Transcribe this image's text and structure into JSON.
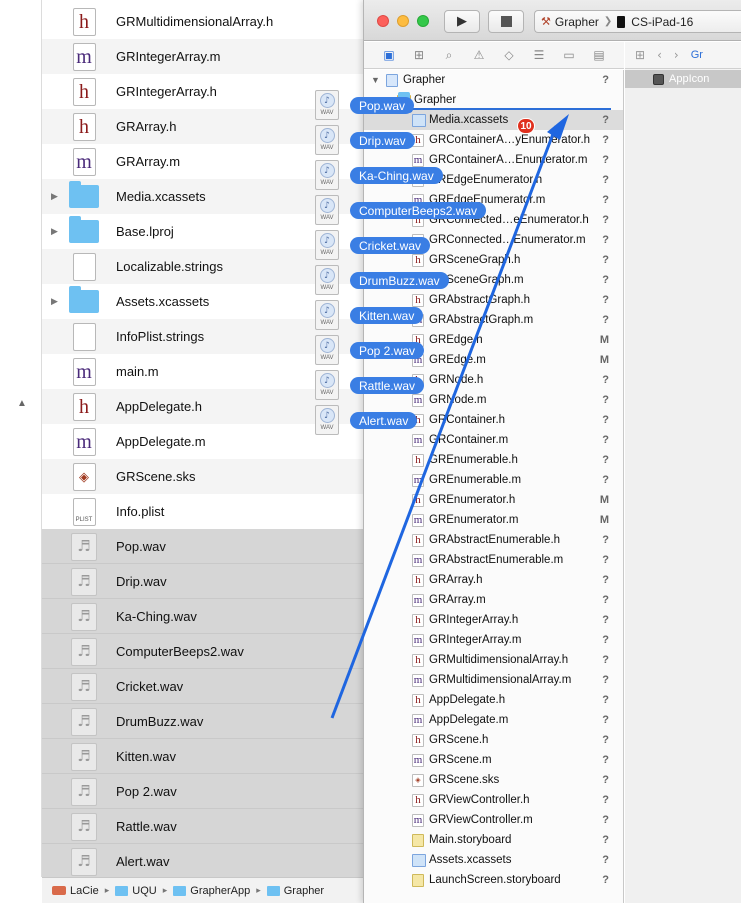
{
  "finder": {
    "rows": [
      {
        "name": "GRMultidimensionalArray.h",
        "type": "h"
      },
      {
        "name": "GRIntegerArray.m",
        "type": "m"
      },
      {
        "name": "GRIntegerArray.h",
        "type": "h"
      },
      {
        "name": "GRArray.h",
        "type": "h"
      },
      {
        "name": "GRArray.m",
        "type": "m"
      },
      {
        "name": "Media.xcassets",
        "type": "folder"
      },
      {
        "name": "Base.lproj",
        "type": "folder"
      },
      {
        "name": "Localizable.strings",
        "type": "plain"
      },
      {
        "name": "Assets.xcassets",
        "type": "folder"
      },
      {
        "name": "InfoPlist.strings",
        "type": "plain"
      },
      {
        "name": "main.m",
        "type": "m"
      },
      {
        "name": "AppDelegate.h",
        "type": "h"
      },
      {
        "name": "AppDelegate.m",
        "type": "m"
      },
      {
        "name": "GRScene.sks",
        "type": "sks"
      },
      {
        "name": "Info.plist",
        "type": "plist"
      },
      {
        "name": "Pop.wav",
        "type": "audio"
      },
      {
        "name": "Drip.wav",
        "type": "audio"
      },
      {
        "name": "Ka-Ching.wav",
        "type": "audio"
      },
      {
        "name": "ComputerBeeps2.wav",
        "type": "audio"
      },
      {
        "name": "Cricket.wav",
        "type": "audio"
      },
      {
        "name": "DrumBuzz.wav",
        "type": "audio"
      },
      {
        "name": "Kitten.wav",
        "type": "audio"
      },
      {
        "name": "Pop 2.wav",
        "type": "audio"
      },
      {
        "name": "Rattle.wav",
        "type": "audio"
      },
      {
        "name": "Alert.wav",
        "type": "audio"
      }
    ],
    "plist_label": "PLIST",
    "audio_glyph": "♬",
    "path": [
      "LaCie",
      "UQU",
      "GrapherApp",
      "Grapher"
    ]
  },
  "drag": {
    "items": [
      "Pop.wav",
      "Drip.wav",
      "Ka-Ching.wav",
      "ComputerBeeps2.wav",
      "Cricket.wav",
      "DrumBuzz.wav",
      "Kitten.wav",
      "Pop 2.wav",
      "Rattle.wav",
      "Alert.wav"
    ],
    "icon_label": "WAV",
    "badge_count": "10"
  },
  "xcode": {
    "scheme_app": "Grapher",
    "scheme_device": "CS-iPad-16",
    "navigator": [
      {
        "name": "Grapher",
        "type": "proj",
        "indent": 0,
        "status": "?"
      },
      {
        "name": "Grapher",
        "type": "folder",
        "indent": 1,
        "status": ""
      },
      {
        "name": "Media.xcassets",
        "type": "assets",
        "indent": 2,
        "status": "?"
      },
      {
        "name": "GRContainerA…yEnumerator.h",
        "type": "h",
        "indent": 2,
        "status": "?"
      },
      {
        "name": "GRContainerA…Enumerator.m",
        "type": "m",
        "indent": 2,
        "status": "?"
      },
      {
        "name": "GREdgeEnumerator.h",
        "type": "h",
        "indent": 2,
        "status": "?"
      },
      {
        "name": "GREdgeEnumerator.m",
        "type": "m",
        "indent": 2,
        "status": "?"
      },
      {
        "name": "GRConnected…eEnumerator.h",
        "type": "h",
        "indent": 2,
        "status": "?"
      },
      {
        "name": "GRConnected…Enumerator.m",
        "type": "m",
        "indent": 2,
        "status": "?"
      },
      {
        "name": "GRSceneGraph.h",
        "type": "h",
        "indent": 2,
        "status": "?"
      },
      {
        "name": "GRSceneGraph.m",
        "type": "m",
        "indent": 2,
        "status": "?"
      },
      {
        "name": "GRAbstractGraph.h",
        "type": "h",
        "indent": 2,
        "status": "?"
      },
      {
        "name": "GRAbstractGraph.m",
        "type": "m",
        "indent": 2,
        "status": "?"
      },
      {
        "name": "GREdge.h",
        "type": "h",
        "indent": 2,
        "status": "M"
      },
      {
        "name": "GREdge.m",
        "type": "m",
        "indent": 2,
        "status": "M"
      },
      {
        "name": "GRNode.h",
        "type": "h",
        "indent": 2,
        "status": "?"
      },
      {
        "name": "GRNode.m",
        "type": "m",
        "indent": 2,
        "status": "?"
      },
      {
        "name": "GRContainer.h",
        "type": "h",
        "indent": 2,
        "status": "?"
      },
      {
        "name": "GRContainer.m",
        "type": "m",
        "indent": 2,
        "status": "?"
      },
      {
        "name": "GREnumerable.h",
        "type": "h",
        "indent": 2,
        "status": "?"
      },
      {
        "name": "GREnumerable.m",
        "type": "m",
        "indent": 2,
        "status": "?"
      },
      {
        "name": "GREnumerator.h",
        "type": "h",
        "indent": 2,
        "status": "M"
      },
      {
        "name": "GREnumerator.m",
        "type": "m",
        "indent": 2,
        "status": "M"
      },
      {
        "name": "GRAbstractEnumerable.h",
        "type": "h",
        "indent": 2,
        "status": "?"
      },
      {
        "name": "GRAbstractEnumerable.m",
        "type": "m",
        "indent": 2,
        "status": "?"
      },
      {
        "name": "GRArray.h",
        "type": "h",
        "indent": 2,
        "status": "?"
      },
      {
        "name": "GRArray.m",
        "type": "m",
        "indent": 2,
        "status": "?"
      },
      {
        "name": "GRIntegerArray.h",
        "type": "h",
        "indent": 2,
        "status": "?"
      },
      {
        "name": "GRIntegerArray.m",
        "type": "m",
        "indent": 2,
        "status": "?"
      },
      {
        "name": "GRMultidimensionalArray.h",
        "type": "h",
        "indent": 2,
        "status": "?"
      },
      {
        "name": "GRMultidimensionalArray.m",
        "type": "m",
        "indent": 2,
        "status": "?"
      },
      {
        "name": "AppDelegate.h",
        "type": "h",
        "indent": 2,
        "status": "?"
      },
      {
        "name": "AppDelegate.m",
        "type": "m",
        "indent": 2,
        "status": "?"
      },
      {
        "name": "GRScene.h",
        "type": "h",
        "indent": 2,
        "status": "?"
      },
      {
        "name": "GRScene.m",
        "type": "m",
        "indent": 2,
        "status": "?"
      },
      {
        "name": "GRScene.sks",
        "type": "sks",
        "indent": 2,
        "status": "?"
      },
      {
        "name": "GRViewController.h",
        "type": "h",
        "indent": 2,
        "status": "?"
      },
      {
        "name": "GRViewController.m",
        "type": "m",
        "indent": 2,
        "status": "?"
      },
      {
        "name": "Main.storyboard",
        "type": "sb",
        "indent": 2,
        "status": "?"
      },
      {
        "name": "Assets.xcassets",
        "type": "assets",
        "indent": 2,
        "status": "?"
      },
      {
        "name": "LaunchScreen.storyboard",
        "type": "sb",
        "indent": 2,
        "status": "?"
      }
    ],
    "editor_jump_label": "Gr",
    "asset_item": "AppIcon"
  },
  "colors": {
    "drag_pill": "#3a7ee4",
    "selection_blue": "#2d6fd8",
    "badge_red": "#e0301e"
  }
}
